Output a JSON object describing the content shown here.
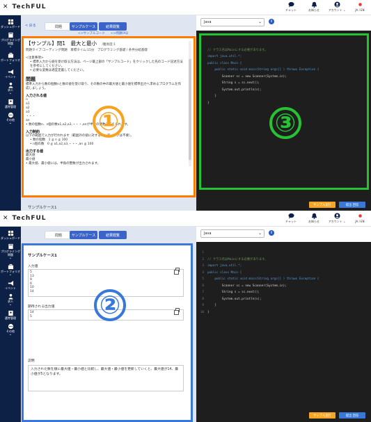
{
  "brand": {
    "close": "✕",
    "name": "TechFUL"
  },
  "header": {
    "chat": "チャット",
    "notice": "お知らせ",
    "account": "アカウント ⌄",
    "lang": "JA / EN"
  },
  "sidebar": [
    {
      "icon": "dashboard-icon",
      "label": "ダッシュボード"
    },
    {
      "icon": "book-icon",
      "label": "プログラミング問題"
    },
    {
      "icon": "briefcase-icon",
      "label": "ポートフォリオ"
    },
    {
      "icon": "megaphone-icon",
      "label": "イベント"
    },
    {
      "icon": "person-icon",
      "label": "求人"
    },
    {
      "icon": "user-card-icon",
      "label": "選考管理"
    },
    {
      "icon": "more-icon",
      "label": "その他"
    }
  ],
  "tabs": {
    "back": "< 戻る",
    "problem": "問題",
    "sample": "サンプルケース",
    "result": "結果閲覧"
  },
  "links": {
    "sample_code": "<>サンプルコード",
    "faq": "<>問題FAQ"
  },
  "problem": {
    "title": "【サンプル】問1　最大と最小",
    "level": "/難易度:1",
    "meta": "問題タイプ:コーディング問題　目標タイム:15分　プログラミング基礎 / 条件分岐基礎",
    "notes_head": "<注意事項>",
    "notes": [
      "標準入力から値を受け取る方法は、ページ最上部の「サンプルコード」をクリックした先のコード記述方法を参考にしてください。",
      "必要な変数は適宜定義してください。"
    ],
    "section_problem": "問題",
    "problem_text": "標準入力から数の個数nと数の値を受け取り、その数の中の最大値と最小値を標準出力へ求めるプログラムを作成しましょう。",
    "section_input": "入力される値",
    "input_lines": [
      "n",
      "a1",
      "a2",
      "a3",
      "・・・",
      "an"
    ],
    "input_note": "数の個数n、n個の数a1,a2,a3,・・・,anが半角の整数で与えられます。",
    "section_constraint": "入力制約",
    "constraint_intro": "以下の範囲で入力が行われます（範囲外の値に対するコーディングは不要）。",
    "constraints": [
      "数の個数　1 ≦ n ≦ 100",
      "n個の数　0 ≦ a1,a2,a3,・・・,an ≦ 100"
    ],
    "section_output": "出力する値",
    "output_lines": [
      "最大値",
      "最小値"
    ],
    "output_note": "最大値、最小値には、半角の整数が出力されます。"
  },
  "sample_case_label": "サンプルケース1",
  "editor": {
    "language": "Java",
    "lines": [
      {
        "t": "// クラス名はMainにする必要があります。",
        "c": "cm"
      },
      {
        "t": "import java.util.*;",
        "c": "kw"
      },
      {
        "t": "",
        "c": ""
      },
      {
        "t": "public class Main {",
        "c": "kw"
      },
      {
        "t": "    public static void main(String args[] ) throws Exception {",
        "c": "kw"
      },
      {
        "t": "        Scanner sc = new Scanner(System.in);",
        "c": "ty"
      },
      {
        "t": "        String s = sc.next();",
        "c": "ty"
      },
      {
        "t": "        System.out.println(s);",
        "c": "ty"
      },
      {
        "t": "    }",
        "c": "ty"
      },
      {
        "t": "}",
        "c": "ty"
      }
    ],
    "run_sample": "サンプル実行",
    "submit": "提出 回答"
  },
  "sample_panel": {
    "title": "サンプルケース1",
    "input_label": "入力値",
    "input_value": "5\n13\n9\n6\n10\n14",
    "output_label": "期待される出力値",
    "output_value": "14\n5",
    "desc_label": "説明",
    "desc_text": "入力された数を順に最大値・最小値と比較し、最大値・最小値を更新していくと、最大値が14、最小値が5となります。"
  },
  "markers": {
    "one": "①",
    "two": "②",
    "three": "③"
  }
}
